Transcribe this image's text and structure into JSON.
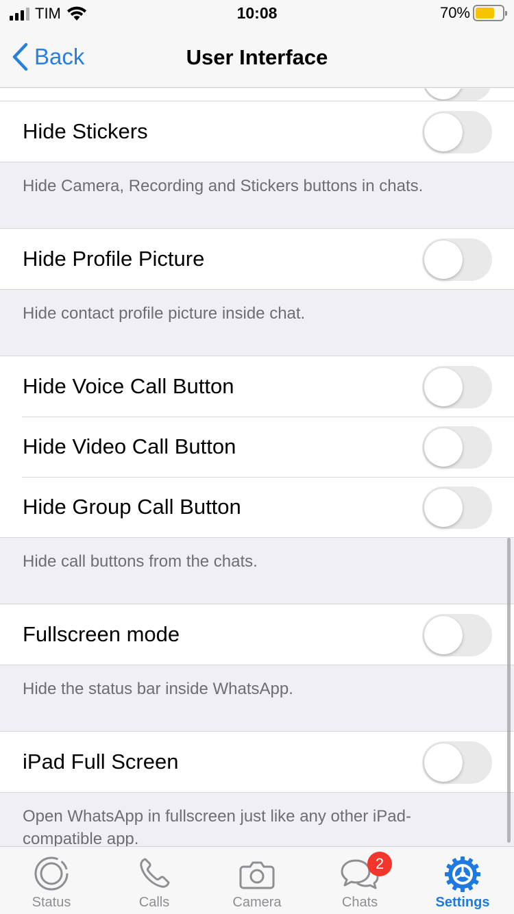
{
  "status_bar": {
    "carrier": "TIM",
    "time": "10:08",
    "battery_pct": "70%",
    "battery_level": 0.7,
    "battery_color": "#f7c400"
  },
  "nav": {
    "back_label": "Back",
    "title": "User Interface",
    "accent": "#2a7fde"
  },
  "sections": [
    {
      "rows": [
        {
          "label": "Hide Stickers",
          "on": false
        }
      ],
      "footer": "Hide Camera, Recording and Stickers buttons in chats."
    },
    {
      "rows": [
        {
          "label": "Hide Profile Picture",
          "on": false
        }
      ],
      "footer": "Hide contact profile picture inside chat."
    },
    {
      "rows": [
        {
          "label": "Hide Voice Call Button",
          "on": false
        },
        {
          "label": "Hide Video Call Button",
          "on": false
        },
        {
          "label": "Hide Group Call Button",
          "on": false
        }
      ],
      "footer": "Hide call buttons from the chats."
    },
    {
      "rows": [
        {
          "label": "Fullscreen mode",
          "on": false
        }
      ],
      "footer": "Hide the status bar inside WhatsApp."
    },
    {
      "rows": [
        {
          "label": "iPad Full Screen",
          "on": false
        }
      ],
      "footer": "Open WhatsApp in fullscreen just like any other iPad-compatible app."
    }
  ],
  "tabs": [
    {
      "label": "Status",
      "icon": "status-icon",
      "active": false
    },
    {
      "label": "Calls",
      "icon": "phone-icon",
      "active": false
    },
    {
      "label": "Camera",
      "icon": "camera-icon",
      "active": false
    },
    {
      "label": "Chats",
      "icon": "chats-icon",
      "active": false,
      "badge": "2"
    },
    {
      "label": "Settings",
      "icon": "settings-icon",
      "active": true
    }
  ]
}
